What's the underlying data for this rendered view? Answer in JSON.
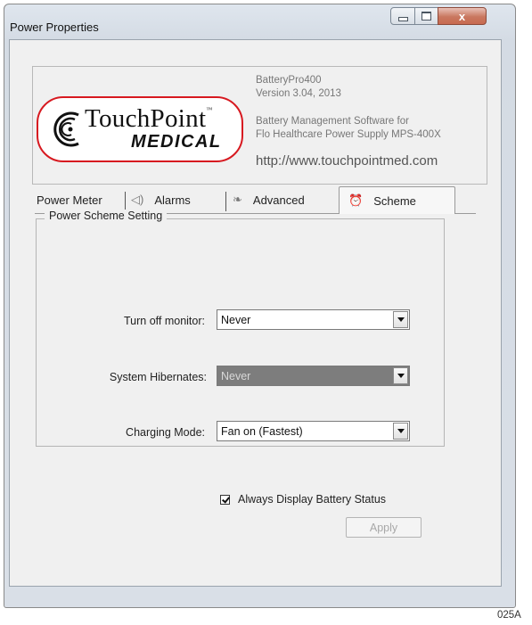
{
  "window": {
    "title": "Power Properties",
    "controls": {
      "minimize": "minimize",
      "maximize": "maximize",
      "close": "x"
    }
  },
  "header": {
    "logo_name": "TouchPoint",
    "logo_tm": "™",
    "logo_sub": "MEDICAL",
    "app_name": "BatteryPro400",
    "version": "Version  3.04, 2013",
    "description_line1": "Battery Management Software for",
    "description_line2": "Flo Healthcare Power Supply MPS-400X",
    "url": "http://www.touchpointmed.com"
  },
  "tabs": [
    {
      "label": "Power Meter",
      "icon": "none",
      "active": false
    },
    {
      "label": "Alarms",
      "icon": "speaker-icon",
      "active": false
    },
    {
      "label": "Advanced",
      "icon": "advanced-icon",
      "active": false
    },
    {
      "label": "Scheme",
      "icon": "clock-icon",
      "active": true
    }
  ],
  "scheme": {
    "group_title": "Power Scheme Setting",
    "fields": [
      {
        "label": "Turn off monitor:",
        "value": "Never",
        "selected": false
      },
      {
        "label": "System Hibernates:",
        "value": "Never",
        "selected": true
      },
      {
        "label": "Charging Mode:",
        "value": "Fan on  (Fastest)",
        "selected": false
      }
    ],
    "always_display_label": "Always Display Battery Status",
    "always_display_checked": true,
    "apply_label": "Apply",
    "apply_enabled": false
  },
  "figure_code": "025A",
  "colors": {
    "logo_border": "#d71920",
    "selected_combo": "#7d7d7d"
  }
}
